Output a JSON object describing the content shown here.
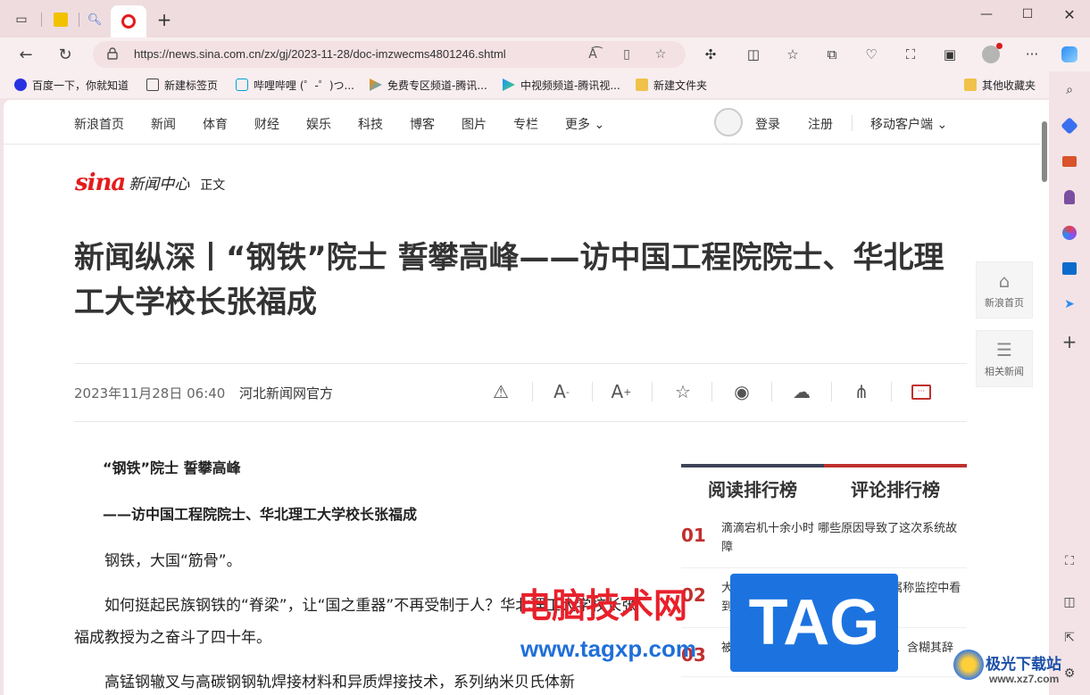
{
  "browser": {
    "url": "https://news.sina.com.cn/zx/gj/2023-11-28/doc-imzwecms4801246.shtml",
    "bookmarks": [
      {
        "label": "百度一下，你就知道",
        "icon": "baidu-paw-icon",
        "color": "#2932e1"
      },
      {
        "label": "新建标签页",
        "icon": "new-tab-icon",
        "color": "#444444"
      },
      {
        "label": "哔哩哔哩 (゜-゜)つ...",
        "icon": "bilibili-icon",
        "color": "#00a1d6"
      },
      {
        "label": "免费专区频道-腾讯...",
        "icon": "tencent-video-icon",
        "color": "#ff8a00"
      },
      {
        "label": "中视频频道-腾讯视...",
        "icon": "tencent-video-icon",
        "color": "#1e90ff"
      },
      {
        "label": "新建文件夹",
        "icon": "folder-icon",
        "color": "#e8b13a"
      }
    ],
    "other_bookmarks": "其他收藏夹"
  },
  "site": {
    "nav": [
      "新浪首页",
      "新闻",
      "体育",
      "财经",
      "娱乐",
      "科技",
      "博客",
      "图片",
      "专栏",
      "更多"
    ],
    "login": "登录",
    "register": "注册",
    "mobile": "移动客户端",
    "brand_sina": "sina",
    "brand_center": "新闻中心",
    "breadcrumb": "正文"
  },
  "article": {
    "title": "新闻纵深丨“钢铁”院士 誓攀高峰——访中国工程院院士、华北理工大学校长张福成",
    "date": "2023年11月28日 06:40",
    "source": "河北新闻网官方",
    "paragraphs": [
      {
        "text": "“钢铁”院士 誓攀高峰",
        "bold": true
      },
      {
        "text": "——访中国工程院院士、华北理工大学校长张福成",
        "bold": true
      },
      {
        "text": "钢铁，大国“筋骨”。",
        "bold": false
      },
      {
        "text": "如何挺起民族钢铁的“脊梁”，让“国之重器”不再受制于人？华北理工大学校长张福成教授为之奋斗了四十年。",
        "bold": false
      },
      {
        "text": "高锰钢辙叉与高碳钢钢轨焊接材料和异质焊接技术，系列纳米贝氏体新",
        "bold": false
      }
    ]
  },
  "float": {
    "home": "新浪首页",
    "related": "相关新闻"
  },
  "ranking": {
    "tab_read": "阅读排行榜",
    "tab_comment": "评论排行榜",
    "items": [
      {
        "num": "01",
        "text": "滴滴宕机十余小时 哪些原因导致了这次系统故障"
      },
      {
        "num": "02",
        "text": "大学生湖中溺亡坠崖失联7天：亲属称监控中看到异常 警方…"
      },
      {
        "num": "03",
        "text": "被要求拿出证据，美方却支支吾吾、含糊其辞"
      }
    ]
  },
  "watermarks": {
    "site_cn": "电脑技术网",
    "site_url": "www.tagxp.com",
    "tag": "TAG",
    "corner": "极光下载站",
    "corner_url": "www.xz7.com"
  }
}
